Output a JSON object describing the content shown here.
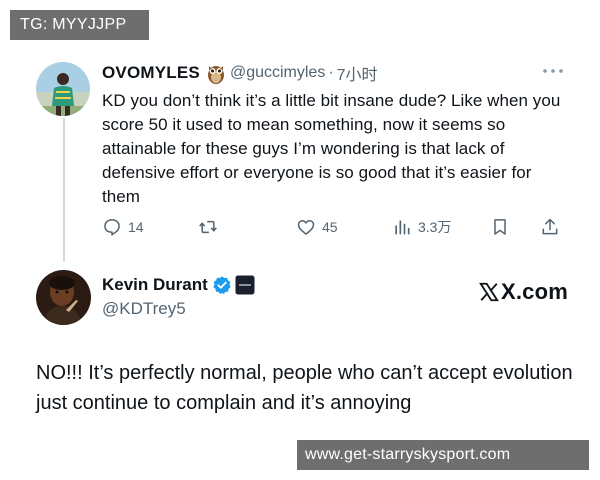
{
  "watermark_top": "TG: MYYJJPP",
  "watermark_bottom": "www.get-starryskysport.com",
  "tweet": {
    "display_name": "OVOMYLES",
    "badge_icon": "owl-emoji-icon",
    "handle": "@guccimyles",
    "separator": "·",
    "time": "7小时",
    "text": "KD you don’t think it’s a little bit insane dude? Like when you score 50 it used to mean something, now it seems so attainable for these guys I’m wondering is that lack of defensive effort or everyone is so good that it’s easier for them",
    "actions": {
      "reply_count": "14",
      "retweet_count": "",
      "like_count": "45",
      "views_count": "3.3万"
    }
  },
  "reply": {
    "display_name": "Kevin Durant",
    "handle": "@KDTrey5",
    "verified_color": "#1d9bf0",
    "brand": "X.com",
    "text": "NO!!! It’s perfectly normal, people who can’t accept evolution just continue to complain and it’s annoying"
  },
  "colors": {
    "secondary_text": "#536471",
    "watermark_bg": "#6e6e6e"
  }
}
